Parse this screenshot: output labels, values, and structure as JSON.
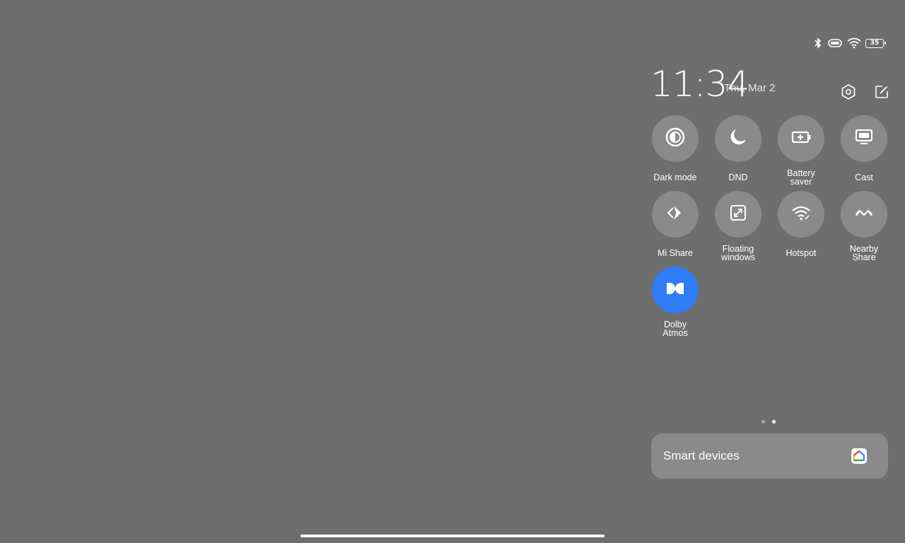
{
  "status_bar": {
    "icons": [
      "bluetooth-icon",
      "vibrate-icon",
      "wifi-icon",
      "battery-icon"
    ],
    "battery_level": "35"
  },
  "header": {
    "time": "11:34",
    "date": "Thu, Mar 2",
    "icons": [
      "settings-icon",
      "edit-icon"
    ]
  },
  "tiles": [
    {
      "label": "Dark mode",
      "icon": "dark-mode-icon",
      "active": false
    },
    {
      "label": "DND",
      "icon": "moon-icon",
      "active": false
    },
    {
      "label": "Battery\nsaver",
      "icon": "battery-saver-icon",
      "active": false
    },
    {
      "label": "Cast",
      "icon": "cast-icon",
      "active": false
    },
    {
      "label": "Mi Share",
      "icon": "mi-share-icon",
      "active": false
    },
    {
      "label": "Floating\nwindows",
      "icon": "floating-windows-icon",
      "active": false
    },
    {
      "label": "Hotspot",
      "icon": "hotspot-icon",
      "active": false
    },
    {
      "label": "Nearby\nShare",
      "icon": "nearby-share-icon",
      "active": false
    },
    {
      "label": "Dolby\nAtmos",
      "icon": "dolby-icon",
      "active": true
    }
  ],
  "pagination": {
    "pages": 2,
    "current": 2
  },
  "smart_devices": {
    "label": "Smart devices",
    "icon": "google-home-icon"
  },
  "colors": {
    "background": "#6e6e6e",
    "tile": "#8a8a8a",
    "active_tile": "#2f7cf6"
  }
}
